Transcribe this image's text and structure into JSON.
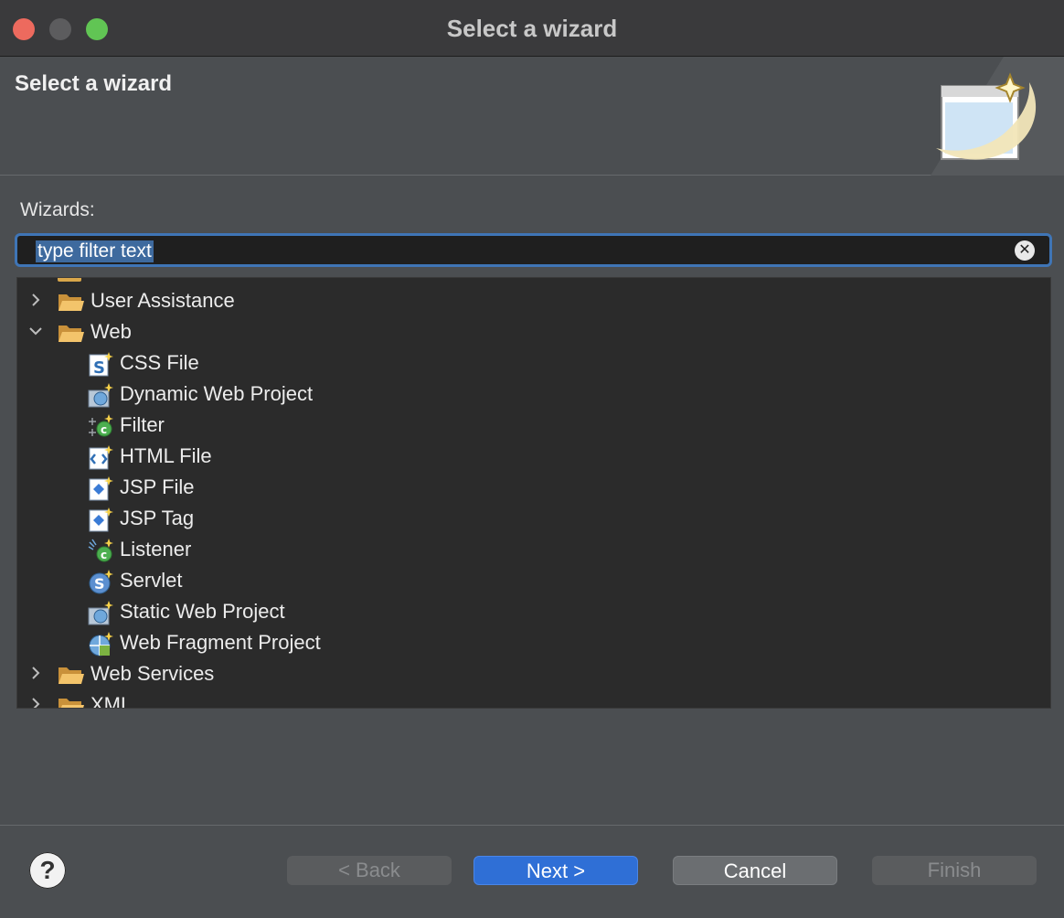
{
  "window": {
    "title": "Select a wizard"
  },
  "header": {
    "title": "Select a wizard"
  },
  "filter": {
    "label": "Wizards:",
    "value": "type filter text"
  },
  "tree": {
    "items": [
      {
        "label": "User Assistance",
        "type": "folder",
        "expanded": false
      },
      {
        "label": "Web",
        "type": "folder",
        "expanded": true
      },
      {
        "label": "CSS File",
        "type": "file",
        "icon": "css-file-icon"
      },
      {
        "label": "Dynamic Web Project",
        "type": "file",
        "icon": "dynamic-web-project-icon"
      },
      {
        "label": "Filter",
        "type": "file",
        "icon": "filter-icon"
      },
      {
        "label": "HTML File",
        "type": "file",
        "icon": "html-file-icon"
      },
      {
        "label": "JSP File",
        "type": "file",
        "icon": "jsp-file-icon"
      },
      {
        "label": "JSP Tag",
        "type": "file",
        "icon": "jsp-tag-icon"
      },
      {
        "label": "Listener",
        "type": "file",
        "icon": "listener-icon"
      },
      {
        "label": "Servlet",
        "type": "file",
        "icon": "servlet-icon"
      },
      {
        "label": "Static Web Project",
        "type": "file",
        "icon": "static-web-project-icon"
      },
      {
        "label": "Web Fragment Project",
        "type": "file",
        "icon": "web-fragment-project-icon"
      },
      {
        "label": "Web Services",
        "type": "folder",
        "expanded": false
      },
      {
        "label": "XML",
        "type": "folder",
        "expanded": false
      }
    ]
  },
  "buttons": {
    "help": "?",
    "back": "< Back",
    "next": "Next >",
    "cancel": "Cancel",
    "finish": "Finish"
  },
  "colors": {
    "accent": "#2f6fd6",
    "focus": "#3f75b6",
    "selection": "#3e6a9e"
  }
}
